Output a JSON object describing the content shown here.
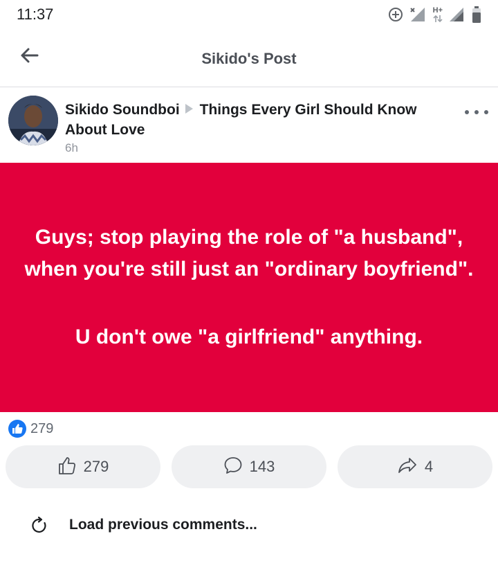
{
  "status_bar": {
    "time": "11:37",
    "network_badge": "H+",
    "icons": [
      "data-saver-icon",
      "signal-no-service-icon",
      "network-activity-icon",
      "signal-strength-icon",
      "battery-icon"
    ]
  },
  "header": {
    "title": "Sikido's Post",
    "back_icon": "back-arrow-icon"
  },
  "post": {
    "author": "Sikido Soundboi",
    "group": "Things Every Girl Should Know About Love",
    "time": "6h",
    "text_main": "Guys; stop playing the role of \"a husband\", when you're still just an \"ordinary boyfriend\".",
    "text_sub": "U don't owe \"a girlfriend\" anything.",
    "background_color": "#e2003c"
  },
  "reactions": {
    "count": "279"
  },
  "actions": {
    "like_count": "279",
    "comment_count": "143",
    "share_count": "4"
  },
  "comments": {
    "load_previous_label": "Load previous comments..."
  },
  "colors": {
    "accent": "#1877f2",
    "post_background": "#e2003c",
    "button_background": "#eff0f2"
  }
}
